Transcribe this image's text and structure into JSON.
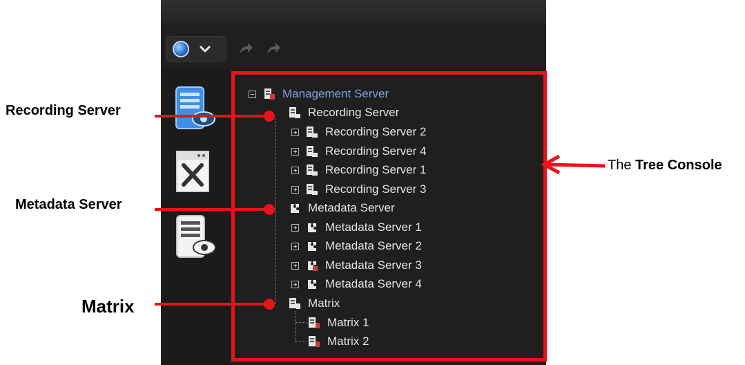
{
  "tree": {
    "root": "Management Server",
    "groups": [
      {
        "label": "Recording Server",
        "children": [
          "Recording Server 2",
          "Recording Server 4",
          "Recording Server 1",
          "Recording Server 3"
        ]
      },
      {
        "label": "Metadata Server",
        "children": [
          "Metadata Server 1",
          "Metadata Server 2",
          "Metadata Server 3",
          "Metadata Server 4"
        ]
      },
      {
        "label": "Matrix",
        "children": [
          "Matrix 1",
          "Matrix 2"
        ]
      }
    ]
  },
  "callouts": {
    "recording": "Recording Server",
    "metadata": "Metadata Server",
    "matrix": "Matrix",
    "tree_prefix": "The ",
    "tree_bold": "Tree Console"
  },
  "colors": {
    "accent": "#e8131a",
    "root_text": "#7fa0dd"
  },
  "icons": [
    "globe-icon",
    "chevron-down-icon",
    "redo-icon",
    "recording-server-icon",
    "tools-icon",
    "viewer-icon",
    "server-icon",
    "metadata-server-icon",
    "matrix-icon"
  ]
}
